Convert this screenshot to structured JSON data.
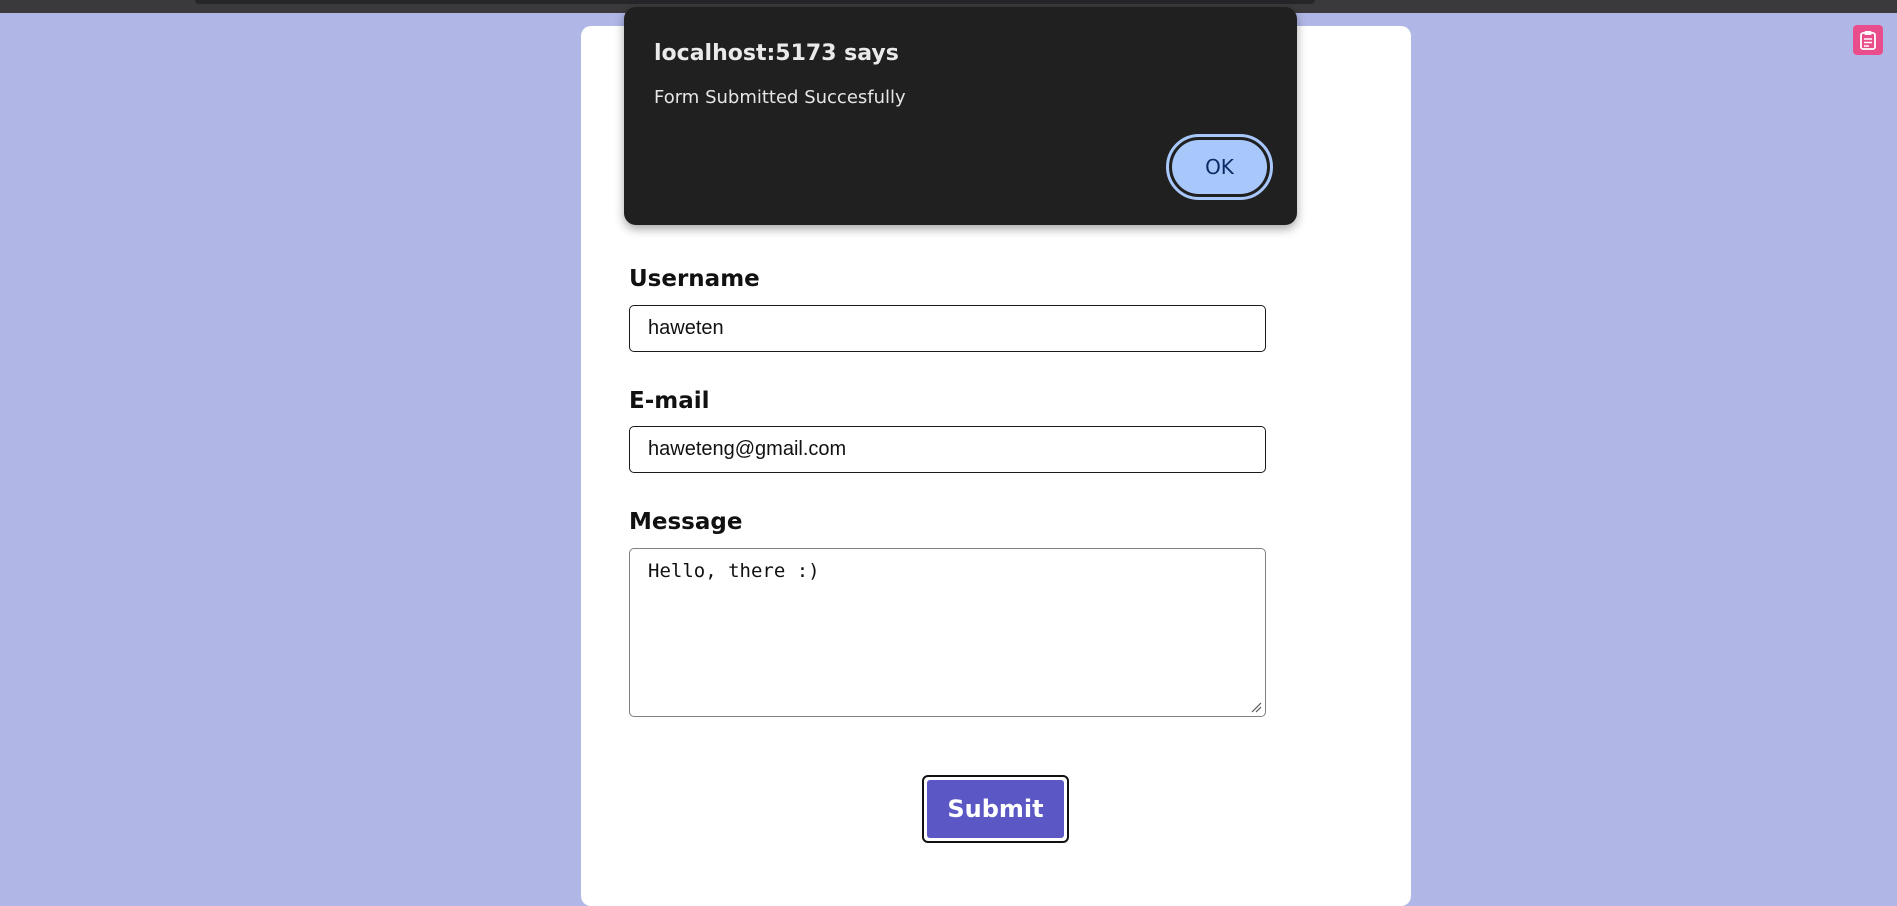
{
  "dialog": {
    "title": "localhost:5173 says",
    "message": "Form Submitted Succesfully",
    "ok_label": "OK"
  },
  "form": {
    "username_label": "Username",
    "username_value": "haweten",
    "email_label": "E-mail",
    "email_value": "haweteng@gmail.com",
    "message_label": "Message",
    "message_value": "Hello, there :)",
    "submit_label": "Submit"
  },
  "colors": {
    "page_background": "#b0b7e6",
    "submit_button": "#5b57c4",
    "dialog_background": "#202020",
    "ok_button": "#a8c7fa",
    "extension_icon": "#e94d8b"
  },
  "icons": {
    "extension": "clipboard-icon",
    "textarea_resize": "resize-handle-icon"
  }
}
